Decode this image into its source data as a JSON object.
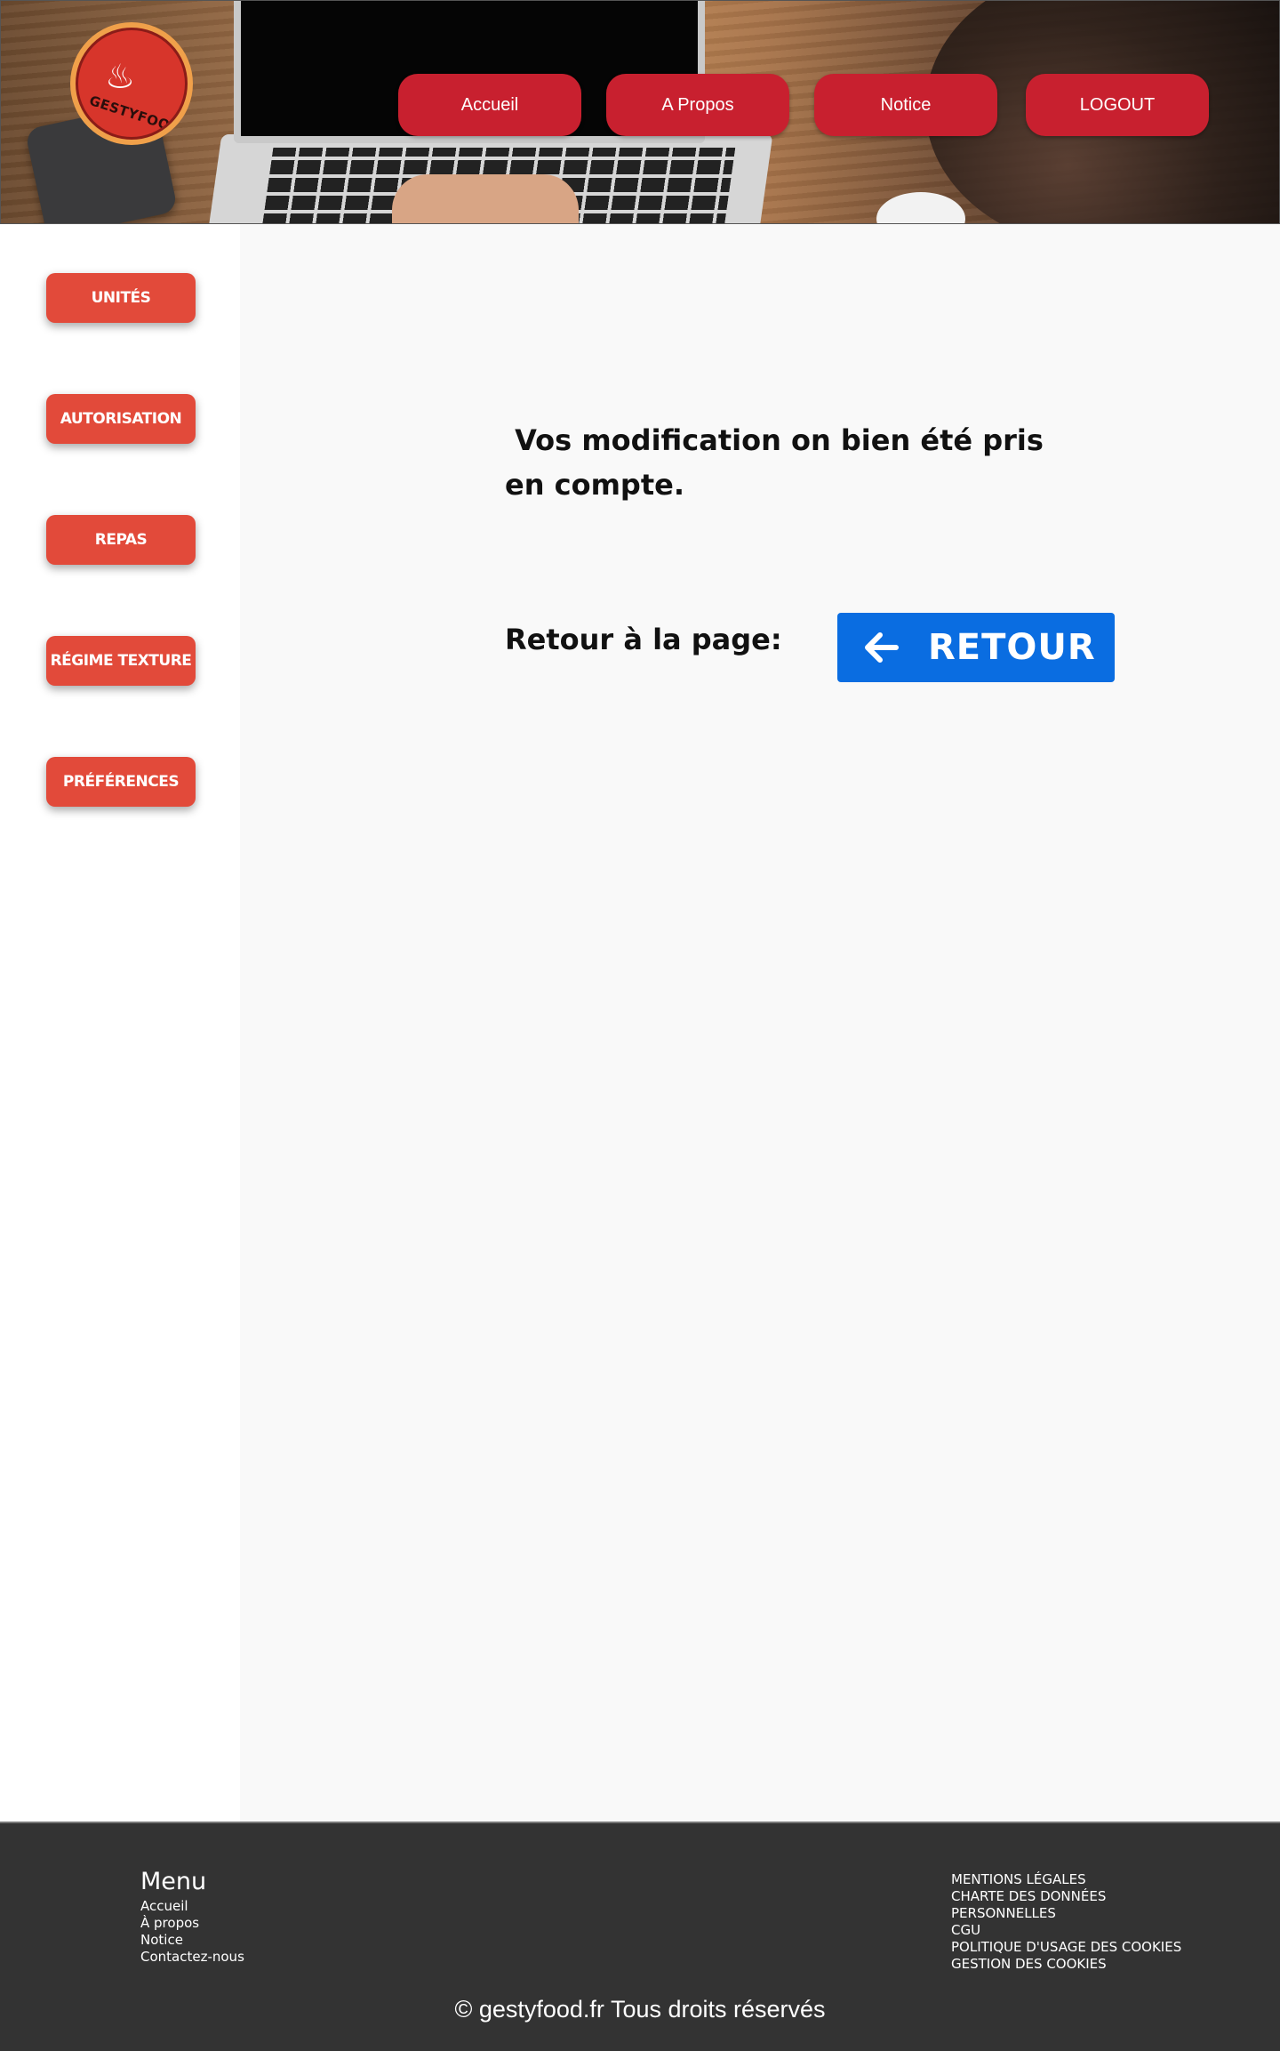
{
  "header": {
    "logo_text": "GESTYFOOD",
    "nav": [
      {
        "label": "Accueil"
      },
      {
        "label": "A Propos"
      },
      {
        "label": "Notice"
      },
      {
        "label": "LOGOUT"
      }
    ]
  },
  "sidebar": {
    "items": [
      {
        "label": "UNITÉS"
      },
      {
        "label": "AUTORISATION"
      },
      {
        "label": "REPAS"
      },
      {
        "label": "RÉGIME TEXTURE"
      },
      {
        "label": "PRÉFÉRENCES"
      }
    ]
  },
  "main": {
    "message": " Vos modification on bien été pris en compte.",
    "return_label": "Retour à la page:",
    "return_button": "RETOUR"
  },
  "footer": {
    "menu_title": "Menu",
    "menu_links": [
      "Accueil",
      "À propos",
      "Notice",
      "Contactez-nous"
    ],
    "legal_links": [
      "MENTIONS LÉGALES",
      "CHARTE DES DONNÉES",
      "PERSONNELLES",
      "CGU",
      "POLITIQUE D'USAGE DES COOKIES",
      "GESTION DES COOKIES"
    ],
    "copyright": "© gestyfood.fr  Tous droits réservés"
  },
  "colors": {
    "nav_button": "#c8202f",
    "side_button": "#e24a3a",
    "return_button": "#0a6de1",
    "footer_bg": "#333333"
  }
}
